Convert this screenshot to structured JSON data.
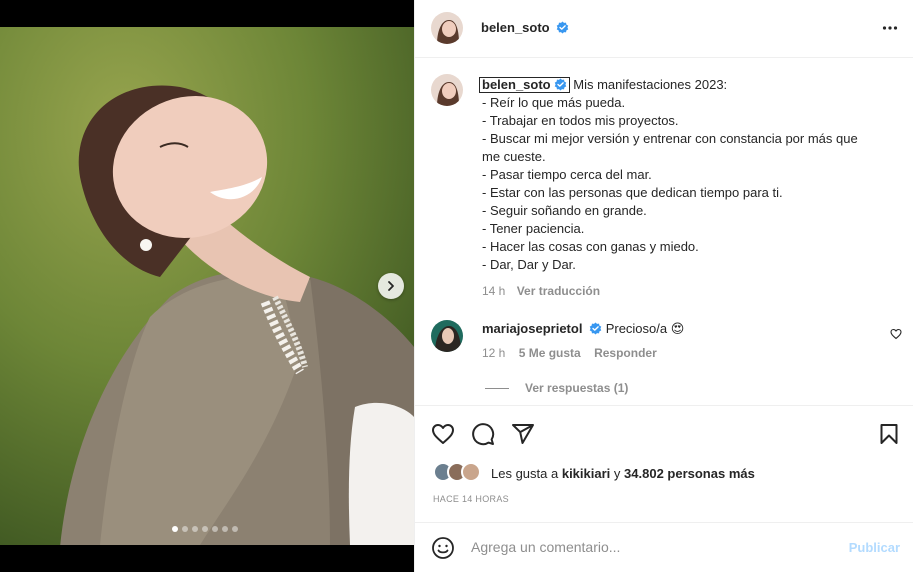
{
  "header": {
    "username": "belen_soto",
    "more_icon": "more-horizontal-icon"
  },
  "caption": {
    "username": "belen_soto",
    "lines": [
      "Mis manifestaciones 2023:",
      "- Reír lo que más pueda.",
      "- Trabajar en todos mis proyectos.",
      "- Buscar mi mejor versión y entrenar con constancia por más que",
      "me cueste.",
      "- Pasar tiempo cerca del mar.",
      "- Estar con las personas que dedican tiempo para ti.",
      "- Seguir soñando en grande.",
      "- Tener paciencia.",
      "- Hacer las cosas con ganas y miedo.",
      "- Dar, Dar y Dar."
    ],
    "time": "14 h",
    "translate_label": "Ver traducción"
  },
  "comment": {
    "username": "mariajoseprietol",
    "text": "Precioso/a",
    "emoji": "😍",
    "time": "12 h",
    "likes": "5 Me gusta",
    "reply_label": "Responder",
    "view_replies": "Ver respuestas (1)"
  },
  "likes": {
    "prefix": "Les gusta a",
    "user": "kikikiari",
    "middle": "y",
    "count": "34.802 personas más"
  },
  "post_time": "HACE 14 HORAS",
  "add_comment": {
    "placeholder": "Agrega un comentario...",
    "post_label": "Publicar"
  },
  "carousel": {
    "slide_count": 7,
    "active_index": 0
  },
  "colors": {
    "verified": "#3897f0",
    "post_disabled": "#b3dbff",
    "meta": "#8e8e8e"
  }
}
